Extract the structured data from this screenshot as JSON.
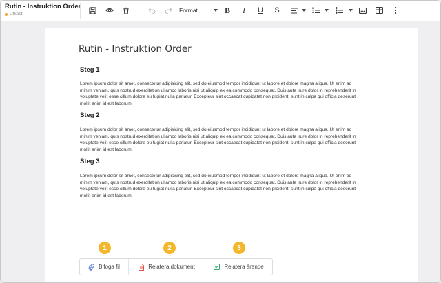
{
  "app": {
    "title": "Rutin - Instruktion Order",
    "status": "Utkast"
  },
  "toolbar": {
    "format_label": "Format",
    "icons": [
      "save-icon",
      "eye-icon",
      "trash-icon",
      "undo-icon",
      "redo-icon",
      "bold-icon",
      "italic-icon",
      "underline-icon",
      "strikethrough-icon",
      "align-icon",
      "numbered-list-icon",
      "bullet-list-icon",
      "image-icon",
      "table-icon",
      "more-icon"
    ],
    "glyphs": {
      "bold": "B",
      "italic": "I",
      "underline": "U",
      "strike": "S"
    }
  },
  "document": {
    "title": "Rutin - Instruktion Order",
    "steps": [
      {
        "heading": "Steg 1",
        "lines": [
          "Lorem ipsum dolor sit amet, consectetur adipisicing elit, sed do eiusmod tempor incididunt ut labore et dolore magna aliqua. Ut enim ad",
          "minim veniam, quis nostrud exercitation ullamco laboris nisi ut aliquip ex ea commodo consequat. Duis aute irure dolor in reprehenderit in",
          "voluptate velit esse cillum dolore eu fugiat nulla pariatur. Excepteur sint occaecat cupidatat non proident, sunt in culpa qui officia deserunt",
          "mollit anim id est laborum."
        ]
      },
      {
        "heading": "Steg 2",
        "lines": [
          "Lorem ipsum dolor sit amet, consectetur adipisicing elit, sed do eiusmod tempor incididunt ut labore et dolore magna aliqua. Ut enim ad",
          "minim veniam, quis nostrud exercitation ullamco laboris nisi ut aliquip ex ea commodo consequat. Duis aute irure dolor in reprehenderit in",
          "voluptate velit esse cillum dolore eu fugiat nulla pariatur. Excepteur sint occaecat cupidatat non proident, sunt in culpa qui officia deserunt",
          "mollit anim id est laborum."
        ]
      },
      {
        "heading": "Steg 3",
        "lines": [
          "Lorem ipsum dolor sit amet, consectetur adipisicing elit, sed do eiusmod tempor incididunt ut labore et dolore magna aliqua. Ut enim ad",
          "minim veniam, quis nostrud exercitation ullamco laboris nisi ut aliquip ex ea commodo consequat. Duis aute irure dolor in reprehenderit in",
          "voluptate velit esse cillum dolore eu fugiat nulla pariatur. Excepteur sint occaecat cupidatat non proident, sunt in culpa qui officia deserunt",
          "mollit anim id est laborum"
        ]
      }
    ]
  },
  "actions": [
    {
      "badge": "1",
      "label": "Bifoga fil",
      "icon": "paperclip-icon",
      "icon_color": "#5b7fd6"
    },
    {
      "badge": "2",
      "label": "Relatera dokument",
      "icon": "document-icon",
      "icon_color": "#e0524f"
    },
    {
      "badge": "3",
      "label": "Relatera ärende",
      "icon": "checkbox-icon",
      "icon_color": "#3aa66a"
    }
  ],
  "colors": {
    "badge": "#f4b62b",
    "status_dot": "#f0a020"
  }
}
